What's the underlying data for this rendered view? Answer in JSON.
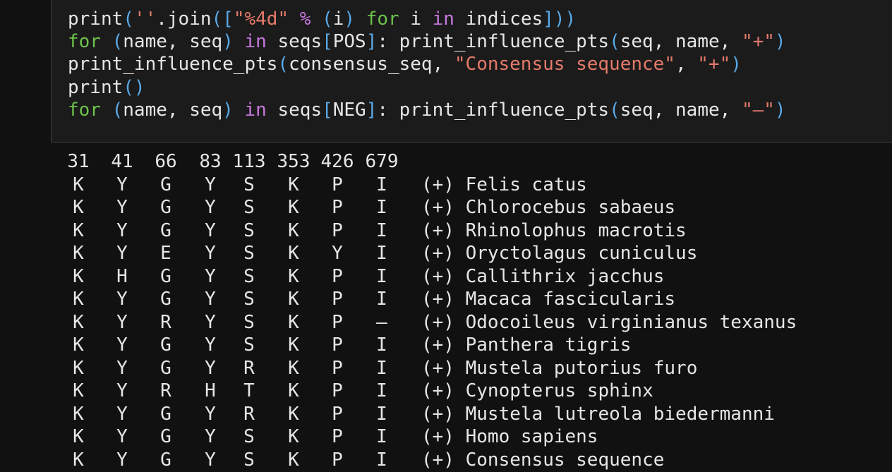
{
  "code": {
    "lines": [
      [
        {
          "t": "print",
          "c": "def"
        },
        {
          "t": "(",
          "c": "paren"
        },
        {
          "t": "''",
          "c": "str"
        },
        {
          "t": ".join",
          "c": "def"
        },
        {
          "t": "(",
          "c": "paren"
        },
        {
          "t": "[",
          "c": "br"
        },
        {
          "t": "\"%4d\"",
          "c": "str"
        },
        {
          "t": " ",
          "c": "def"
        },
        {
          "t": "%",
          "c": "op"
        },
        {
          "t": " ",
          "c": "def"
        },
        {
          "t": "(",
          "c": "paren"
        },
        {
          "t": "i",
          "c": "def"
        },
        {
          "t": ")",
          "c": "paren"
        },
        {
          "t": " ",
          "c": "def"
        },
        {
          "t": "for",
          "c": "kw"
        },
        {
          "t": " i ",
          "c": "def"
        },
        {
          "t": "in",
          "c": "in"
        },
        {
          "t": " indices",
          "c": "def"
        },
        {
          "t": "]",
          "c": "br"
        },
        {
          "t": "))",
          "c": "paren"
        }
      ],
      [
        {
          "t": "for",
          "c": "kw"
        },
        {
          "t": " ",
          "c": "def"
        },
        {
          "t": "(",
          "c": "paren"
        },
        {
          "t": "name, seq",
          "c": "def"
        },
        {
          "t": ")",
          "c": "paren"
        },
        {
          "t": " ",
          "c": "def"
        },
        {
          "t": "in",
          "c": "in"
        },
        {
          "t": " seqs",
          "c": "def"
        },
        {
          "t": "[",
          "c": "br"
        },
        {
          "t": "POS",
          "c": "def"
        },
        {
          "t": "]",
          "c": "br"
        },
        {
          "t": ": print_influence_pts",
          "c": "def"
        },
        {
          "t": "(",
          "c": "paren"
        },
        {
          "t": "seq, name, ",
          "c": "def"
        },
        {
          "t": "\"+\"",
          "c": "str"
        },
        {
          "t": ")",
          "c": "paren"
        }
      ],
      [
        {
          "t": "print_influence_pts",
          "c": "def"
        },
        {
          "t": "(",
          "c": "paren"
        },
        {
          "t": "consensus_seq, ",
          "c": "def"
        },
        {
          "t": "\"Consensus sequence\"",
          "c": "str"
        },
        {
          "t": ", ",
          "c": "def"
        },
        {
          "t": "\"+\"",
          "c": "str"
        },
        {
          "t": ")",
          "c": "paren"
        }
      ],
      [
        {
          "t": "print",
          "c": "def"
        },
        {
          "t": "()",
          "c": "paren"
        }
      ],
      [
        {
          "t": "for",
          "c": "kw"
        },
        {
          "t": " ",
          "c": "def"
        },
        {
          "t": "(",
          "c": "paren"
        },
        {
          "t": "name, seq",
          "c": "def"
        },
        {
          "t": ")",
          "c": "paren"
        },
        {
          "t": " ",
          "c": "def"
        },
        {
          "t": "in",
          "c": "in"
        },
        {
          "t": " seqs",
          "c": "def"
        },
        {
          "t": "[",
          "c": "br"
        },
        {
          "t": "NEG",
          "c": "def"
        },
        {
          "t": "]",
          "c": "br"
        },
        {
          "t": ": print_influence_pts",
          "c": "def"
        },
        {
          "t": "(",
          "c": "paren"
        },
        {
          "t": "seq, name, ",
          "c": "def"
        },
        {
          "t": "\"–\"",
          "c": "str"
        },
        {
          "t": ")",
          "c": "paren"
        }
      ]
    ]
  },
  "output": {
    "header": [
      "31",
      "41",
      "66",
      "83",
      "113",
      "353",
      "426",
      "679"
    ],
    "rows": [
      {
        "residues": [
          "K",
          "Y",
          "G",
          "Y",
          "S",
          "K",
          "P",
          "I"
        ],
        "sign": "(+)",
        "species": "Felis catus"
      },
      {
        "residues": [
          "K",
          "Y",
          "G",
          "Y",
          "S",
          "K",
          "P",
          "I"
        ],
        "sign": "(+)",
        "species": "Chlorocebus sabaeus"
      },
      {
        "residues": [
          "K",
          "Y",
          "G",
          "Y",
          "S",
          "K",
          "P",
          "I"
        ],
        "sign": "(+)",
        "species": "Rhinolophus macrotis"
      },
      {
        "residues": [
          "K",
          "Y",
          "E",
          "Y",
          "S",
          "K",
          "Y",
          "I"
        ],
        "sign": "(+)",
        "species": "Oryctolagus cuniculus"
      },
      {
        "residues": [
          "K",
          "H",
          "G",
          "Y",
          "S",
          "K",
          "P",
          "I"
        ],
        "sign": "(+)",
        "species": "Callithrix jacchus"
      },
      {
        "residues": [
          "K",
          "Y",
          "G",
          "Y",
          "S",
          "K",
          "P",
          "I"
        ],
        "sign": "(+)",
        "species": "Macaca fascicularis"
      },
      {
        "residues": [
          "K",
          "Y",
          "R",
          "Y",
          "S",
          "K",
          "P",
          "–"
        ],
        "sign": "(+)",
        "species": "Odocoileus virginianus texanus"
      },
      {
        "residues": [
          "K",
          "Y",
          "G",
          "Y",
          "S",
          "K",
          "P",
          "I"
        ],
        "sign": "(+)",
        "species": "Panthera tigris"
      },
      {
        "residues": [
          "K",
          "Y",
          "G",
          "Y",
          "R",
          "K",
          "P",
          "I"
        ],
        "sign": "(+)",
        "species": "Mustela putorius furo"
      },
      {
        "residues": [
          "K",
          "Y",
          "R",
          "H",
          "T",
          "K",
          "P",
          "I"
        ],
        "sign": "(+)",
        "species": "Cynopterus sphinx"
      },
      {
        "residues": [
          "K",
          "Y",
          "G",
          "Y",
          "R",
          "K",
          "P",
          "I"
        ],
        "sign": "(+)",
        "species": "Mustela lutreola biedermanni"
      },
      {
        "residues": [
          "K",
          "Y",
          "G",
          "Y",
          "S",
          "K",
          "P",
          "I"
        ],
        "sign": "(+)",
        "species": "Homo sapiens"
      },
      {
        "residues": [
          "K",
          "Y",
          "G",
          "Y",
          "S",
          "K",
          "P",
          "I"
        ],
        "sign": "(+)",
        "species": "Consensus sequence"
      }
    ]
  }
}
